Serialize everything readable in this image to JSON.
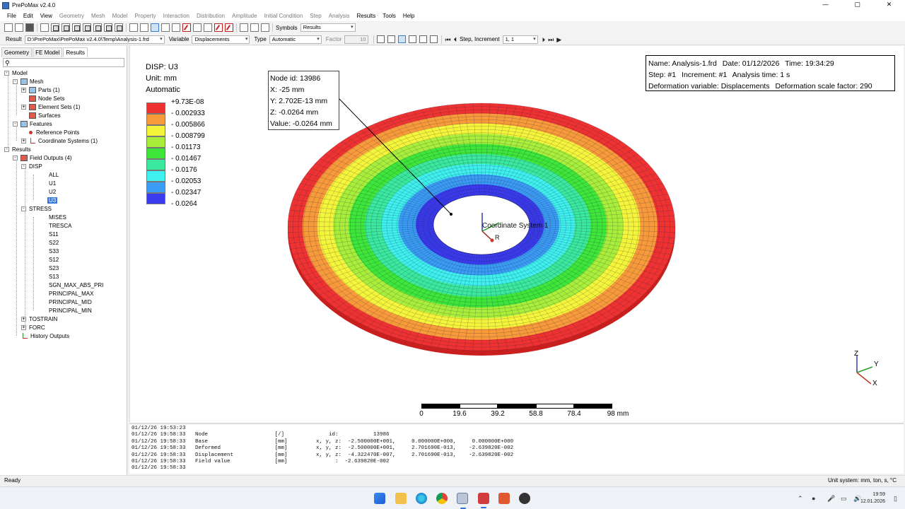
{
  "window": {
    "title": "PrePoMax v2.4.0",
    "minimize": "—",
    "maximize": "▢",
    "close": "✕"
  },
  "menu": [
    {
      "label": "File",
      "enabled": true
    },
    {
      "label": "Edit",
      "enabled": true
    },
    {
      "label": "View",
      "enabled": true
    },
    {
      "label": "Geometry",
      "enabled": false
    },
    {
      "label": "Mesh",
      "enabled": false
    },
    {
      "label": "Model",
      "enabled": false
    },
    {
      "label": "Property",
      "enabled": false
    },
    {
      "label": "Interaction",
      "enabled": false
    },
    {
      "label": "Distribution",
      "enabled": false
    },
    {
      "label": "Amplitude",
      "enabled": false
    },
    {
      "label": "Initial Condition",
      "enabled": false
    },
    {
      "label": "Step",
      "enabled": false
    },
    {
      "label": "Analysis",
      "enabled": false
    },
    {
      "label": "Results",
      "enabled": true
    },
    {
      "label": "Tools",
      "enabled": true
    },
    {
      "label": "Help",
      "enabled": true
    }
  ],
  "toolbar": {
    "symbols_label": "Symbols",
    "symbols_value": "Results"
  },
  "resultbar": {
    "result_label": "Result",
    "result_value": "D:\\PrePoMax\\PrePoMax v2.4.0\\Temp\\Analysis-1.frd",
    "variable_label": "Variable",
    "variable_value": "Displacements",
    "type_label": "Type",
    "type_value": "Automatic",
    "factor_label": "Factor",
    "factor_value": "10",
    "step_label": "Step, Increment",
    "step_value": "1, 1"
  },
  "tabs": [
    "Geometry",
    "FE Model",
    "Results"
  ],
  "tree": {
    "model": "Model",
    "mesh": "Mesh",
    "parts": "Parts (1)",
    "node_sets": "Node Sets",
    "element_sets": "Element Sets (1)",
    "surfaces": "Surfaces",
    "features": "Features",
    "reference_points": "Reference Points",
    "coordinate_systems": "Coordinate Systems (1)",
    "results": "Results",
    "field_outputs": "Field Outputs (4)",
    "disp": "DISP",
    "disp_items": [
      "ALL",
      "U1",
      "U2",
      "U3"
    ],
    "stress": "STRESS",
    "stress_items": [
      "MISES",
      "TRESCA",
      "S11",
      "S22",
      "S33",
      "S12",
      "S23",
      "S13",
      "SGN_MAX_ABS_PRI",
      "PRINCIPAL_MAX",
      "PRINCIPAL_MID",
      "PRINCIPAL_MIN"
    ],
    "tostrain": "TOSTRAIN",
    "forc": "FORC",
    "history_outputs": "History Outputs"
  },
  "legend": {
    "title": "DISP: U3",
    "unit": "Unit: mm",
    "mode": "Automatic",
    "values": [
      "+9.73E-08",
      "- 0.002933",
      "- 0.005866",
      "- 0.008799",
      "- 0.01173",
      "- 0.01467",
      "- 0.0176",
      "- 0.02053",
      "- 0.02347",
      "- 0.0264"
    ],
    "colors": [
      "#ee3232",
      "#f79a3a",
      "#f4f43a",
      "#a8ee3a",
      "#3ee63a",
      "#3ae89e",
      "#3ef0ee",
      "#3a9cf4",
      "#3a3aee"
    ]
  },
  "info": {
    "name": "Name: Analysis-1.frd",
    "date": "Date: 01/12/2026",
    "time": "Time: 19:34:29",
    "step": "Step: #1",
    "increment": "Increment: #1",
    "analysis_time": "Analysis time: 1 s",
    "deformation_variable": "Deformation variable: Displacements",
    "deformation_scale": "Deformation scale factor: 290"
  },
  "node_query": {
    "node_id": "Node id: 13986",
    "x": "X: -25 mm",
    "y": "Y: 2.702E-13 mm",
    "z": "Z: -0.0264 mm",
    "value": "Value: -0.0264 mm"
  },
  "coordinate_system_label": "Coordinate System 1",
  "scale_bar": {
    "ticks": [
      "0",
      "19.6",
      "39.2",
      "58.8",
      "78.4",
      "98 mm"
    ]
  },
  "triad": {
    "z": "Z",
    "y": "Y",
    "x": "X"
  },
  "console": [
    "01/12/26 19:53:23",
    "01/12/26 19:58:33   Node                     [/]              id:           13986",
    "01/12/26 19:58:33   Base                     [mm]         x, y, z:  -2.500000E+001,     0.000000E+000,     0.000000E+000",
    "01/12/26 19:58:33   Deformed                 [mm]         x, y, z:  -2.500000E+001,     2.701690E-013,    -2.639820E-002",
    "01/12/26 19:58:33   Displacement             [mm]         x, y, z:  -4.322470E-007,     2.701690E-013,    -2.639820E-002",
    "01/12/26 19:58:33   Field value              [mm]               :  -2.639820E-002",
    "01/12/26 19:58:33"
  ],
  "status": {
    "left": "Ready",
    "right": "Unit system: mm, ton, s, °C"
  },
  "clock": {
    "time": "19:59",
    "date": "12.01.2026"
  }
}
